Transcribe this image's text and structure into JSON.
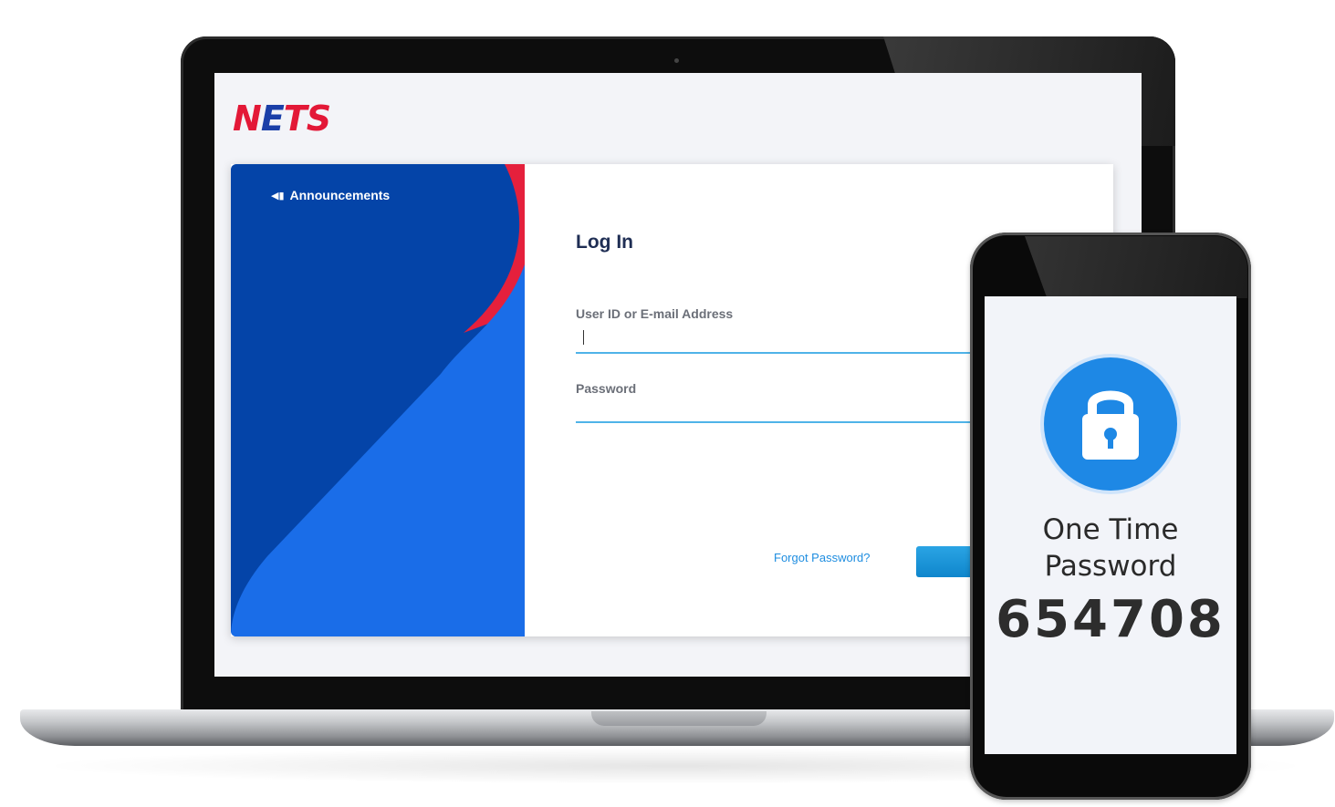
{
  "brand": {
    "logo_left": "N",
    "logo_mid": "E",
    "logo_right": "TS",
    "red": "#e31837",
    "blue": "#1a3fa8"
  },
  "sidebar": {
    "announcements_label": "Announcements",
    "icon": "megaphone-icon"
  },
  "login": {
    "title": "Log In",
    "user_label": "User ID or E-mail Address",
    "user_value": "",
    "password_label": "Password",
    "password_value": "",
    "forgot_label": "Forgot Password?",
    "accent": "#4fb3e8"
  },
  "phone": {
    "icon": "lock-icon",
    "otp_title_line1": "One Time",
    "otp_title_line2": "Password",
    "otp_code": "654708",
    "accent": "#1e88e5"
  }
}
